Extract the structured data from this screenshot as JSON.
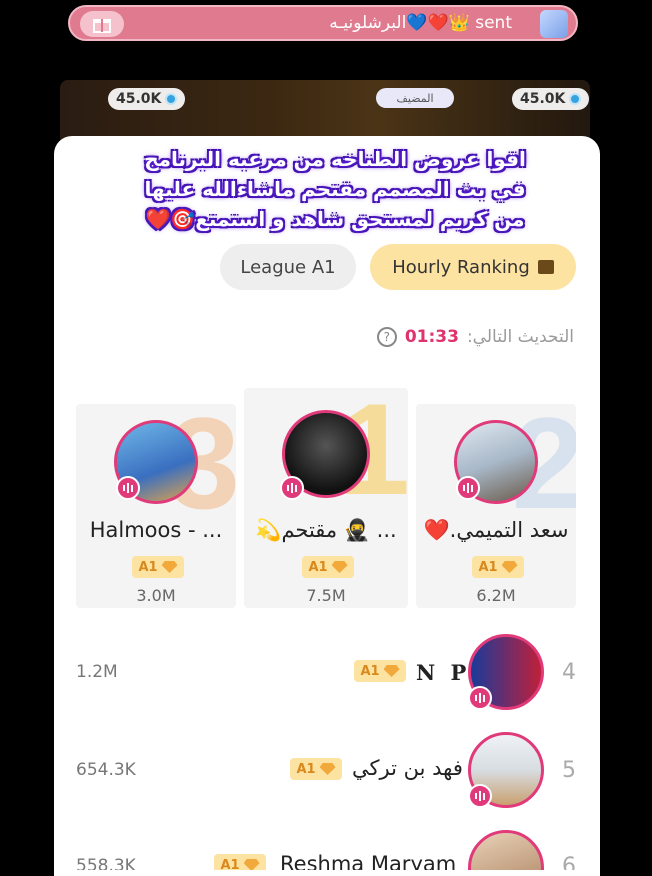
{
  "banner": {
    "text": "sent 👑❤️💙البرشلونيـه",
    "gift_icon": "gift-icon",
    "bg_color": "#e07a8f"
  },
  "room": {
    "left_coins": "45.0K",
    "right_coins": "45.0K",
    "host_label": "المضيف"
  },
  "overlay": {
    "line1": "اقوا عروض الطناخه من مرعبه البرنامج",
    "line2": "في بث المصمم مقتحم ماشاءالله عليها",
    "line3": "من كريم لمستحق شاهد و استمتع🎯❤️"
  },
  "tabs": {
    "league": "League A1",
    "hourly": "Hourly Ranking"
  },
  "update": {
    "label": "التحديث التالي:",
    "time": "01:33",
    "help_icon": "?"
  },
  "podium": [
    {
      "rank": "3",
      "name": "Halmoos - ...",
      "badge": "A1",
      "score": "3.0M",
      "num_color": "#f3d3b8"
    },
    {
      "rank": "1",
      "name": "💫مقتحم 🥷 ...",
      "badge": "A1",
      "score": "7.5M",
      "num_color": "#f6dc9a"
    },
    {
      "rank": "2",
      "name": "سعد التميمي.❤️",
      "badge": "A1",
      "score": "6.2M",
      "num_color": "#d7e2ee"
    }
  ],
  "list": [
    {
      "rank": "4",
      "name": "N P",
      "badge": "A1",
      "score": "1.2M"
    },
    {
      "rank": "5",
      "name": "فهد بن تركي",
      "badge": "A1",
      "score": "654.3K"
    },
    {
      "rank": "6",
      "name": "Reshma Maryam",
      "badge": "A1",
      "score": "558.3K"
    }
  ],
  "colors": {
    "accent_pink": "#e03a7a",
    "hourly_tab": "#fde3a2",
    "timer": "#e0326b"
  }
}
